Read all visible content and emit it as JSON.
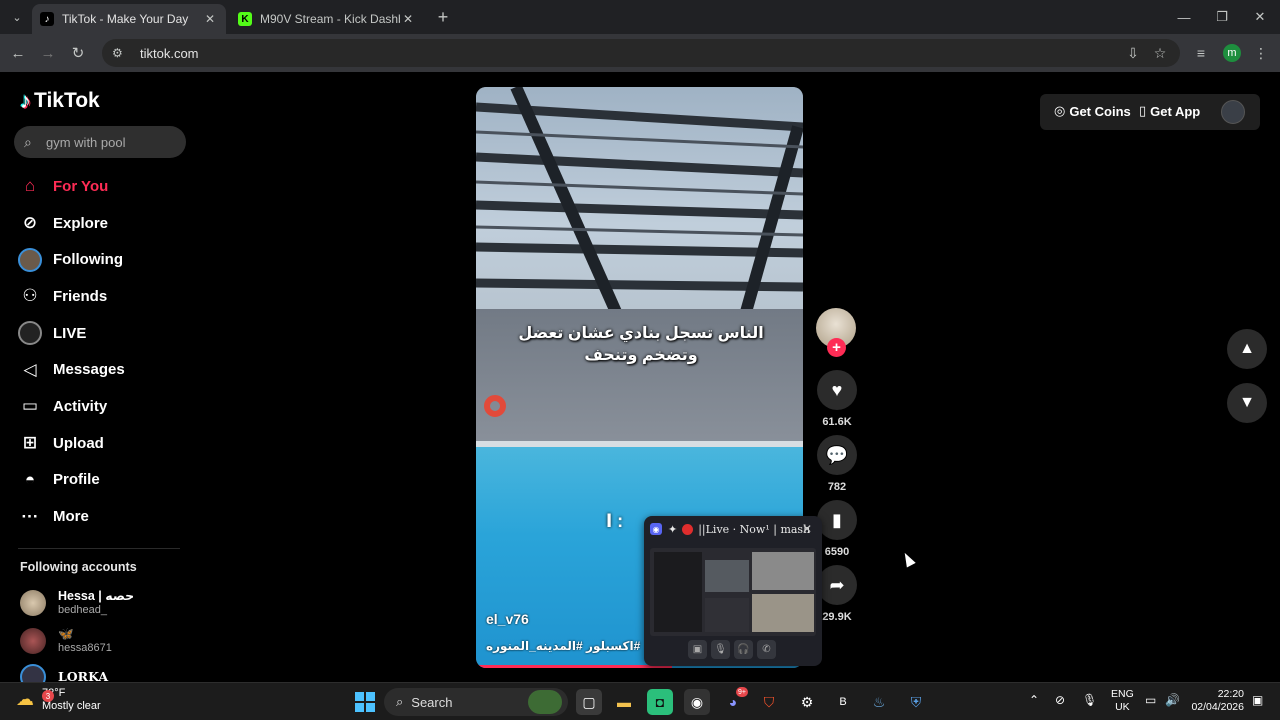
{
  "browser": {
    "tabs": [
      {
        "title": "TikTok - Make Your Day",
        "active": true
      },
      {
        "title": "M90V Stream - Kick Dashboard",
        "active": false
      }
    ],
    "url": "tiktok.com",
    "profile_initial": "m"
  },
  "tiktok": {
    "logo_text": "TikTok",
    "search_placeholder": "gym with pool",
    "nav": [
      {
        "label": "For You",
        "icon": "home-icon",
        "active": true
      },
      {
        "label": "Explore",
        "icon": "compass-icon"
      },
      {
        "label": "Following",
        "icon": "following-avatar"
      },
      {
        "label": "Friends",
        "icon": "friends-icon"
      },
      {
        "label": "LIVE",
        "icon": "live-avatar"
      },
      {
        "label": "Messages",
        "icon": "messages-icon"
      },
      {
        "label": "Activity",
        "icon": "activity-icon"
      },
      {
        "label": "Upload",
        "icon": "upload-icon"
      },
      {
        "label": "Profile",
        "icon": "profile-icon"
      },
      {
        "label": "More",
        "icon": "more-icon"
      }
    ],
    "following_title": "Following accounts",
    "following_accounts": [
      {
        "name": "Hessa | حصه",
        "handle": "bedhead_"
      },
      {
        "name": "🦋",
        "handle": "hessa8671"
      },
      {
        "name": "LORKA",
        "handle": ""
      }
    ],
    "top_right": {
      "coins": "Get Coins",
      "app": "Get App"
    },
    "video": {
      "caption_line1": "الناس تسجل بنادي عشان تعضل",
      "caption_line2": "وتضخم وتنحف",
      "caption_overlay": "ا :",
      "username": "el_v76",
      "tags": "#اكسبلور #المدينه_المنوره",
      "progress": 0.6
    },
    "actions": {
      "likes": "61.6K",
      "comments": "782",
      "saves": "6590",
      "shares": "29.9K"
    }
  },
  "discord_overlay": {
    "title": "||Live · Now¹ | mash"
  },
  "taskbar": {
    "weather_badge": "3",
    "temperature": "72°F",
    "condition": "Mostly clear",
    "search_label": "Search",
    "discord_badge": "9+",
    "lang_top": "ENG",
    "lang_bottom": "UK",
    "time": "22:20",
    "date": "02/04/2026"
  }
}
